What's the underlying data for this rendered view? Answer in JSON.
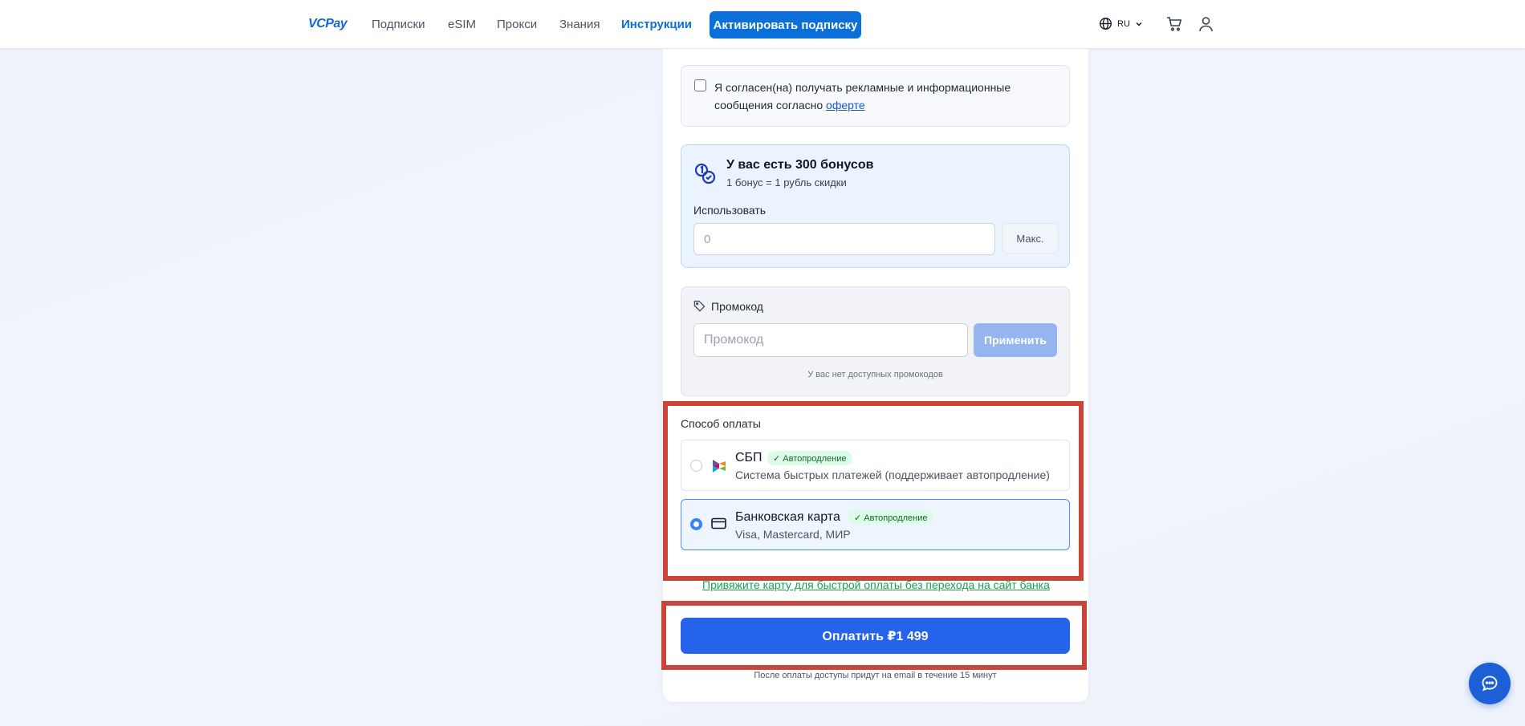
{
  "header": {
    "logo": "VCPay",
    "nav": [
      "Подписки",
      "eSIM",
      "Прокси",
      "Знания",
      "Инструкции"
    ],
    "active_nav": "Инструкции",
    "activate_label": "Активировать подписку",
    "lang": "RU"
  },
  "consent": {
    "text": "Я согласен(на) получать рекламные и информационные сообщения согласно",
    "link": "оферте",
    "checked": false
  },
  "bonus": {
    "title": "У вас есть 300 бонусов",
    "subtitle": "1 бонус = 1 рубль скидки",
    "use_label": "Использовать",
    "input_placeholder": "0",
    "max_label": "Макс."
  },
  "promo": {
    "title": "Промокод",
    "placeholder": "Промокод",
    "apply_label": "Применить",
    "note": "У вас нет доступных промокодов"
  },
  "payment": {
    "label": "Способ оплаты",
    "methods": [
      {
        "name": "СБП",
        "badge": "✓ Автопродление",
        "description": "Система быстрых платежей (поддерживает автопродление)",
        "selected": false
      },
      {
        "name": "Банковская карта",
        "badge": "✓ Автопродление",
        "description": "Visa, Mastercard, МИР",
        "selected": true
      }
    ],
    "link_card": "Привяжите карту для быстрой оплаты без перехода на сайт банка",
    "pay_label": "Оплатить ₽1 499",
    "after_note": "После оплаты доступы придут на email в течение 15 минут"
  },
  "colors": {
    "accent": "#0b6fd9",
    "pay_button": "#2563eb",
    "highlight": "#c9453a",
    "badge_bg": "#dcfce7"
  }
}
